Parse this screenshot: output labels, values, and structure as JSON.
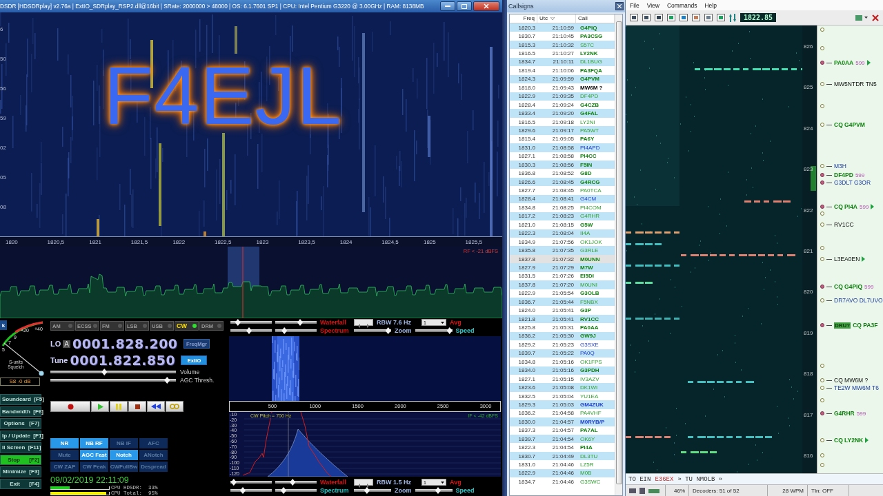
{
  "hdsdr": {
    "title": "DSDR  [HDSDRplay]  v2.76a  |  ExtIO_SDRplay_RSP2.dll@16bit  |  SRate: 2000000 > 48000  |  OS: 6.1.7601 SP1  |  CPU: Intel Pentium G3220 @ 3.00GHz  |  RAM: 8138MB",
    "overlay_text": "F4EJL",
    "time_labels": [
      "6",
      "50",
      "56",
      "59",
      "02",
      "05",
      "08"
    ],
    "freq_axis": [
      "1820",
      "1820,5",
      "1821",
      "1821,5",
      "1822",
      "1822,5",
      "1823",
      "1823,5",
      "1824",
      "1824,5",
      "1825",
      "1825,5"
    ],
    "rf_level": "RF < -21 dBFS",
    "cut_button": "k",
    "meter": {
      "scale": [
        "+20",
        "+40",
        "9",
        "7",
        "5"
      ],
      "label": "S-units Squelch",
      "reading": "S8 -0 dB"
    },
    "modes": [
      {
        "label": "AM",
        "selected": false
      },
      {
        "label": "ECSS",
        "selected": false
      },
      {
        "label": "FM",
        "selected": false
      },
      {
        "label": "LSB",
        "selected": false
      },
      {
        "label": "USB",
        "selected": false
      },
      {
        "label": "CW",
        "selected": true
      },
      {
        "label": "DRM",
        "selected": false
      }
    ],
    "lo": {
      "label": "LO",
      "sub": "A",
      "value": "0001.828.200"
    },
    "tune": {
      "label": "Tune",
      "value": "0001.822.850"
    },
    "side_buttons": [
      {
        "label": "FreqMgr",
        "active": false
      },
      {
        "label": "ExtIO",
        "active": true
      }
    ],
    "sliders": [
      {
        "label": "Volume",
        "level": 0.43
      },
      {
        "label": "AGC Thresh.",
        "level": 0.93
      }
    ],
    "functions": [
      {
        "label": "Soundcard  [F5]",
        "active": false
      },
      {
        "label": "Bandwidth  [F6]",
        "active": false
      },
      {
        "label": "Options   [F7]",
        "active": false
      },
      {
        "label": "lp / Update  [F1]",
        "active": false
      },
      {
        "label": "ll Screen  [F11]",
        "active": false
      },
      {
        "label": "Stop      [F2]",
        "active": true
      },
      {
        "label": "Minimize  [F3]",
        "active": false
      },
      {
        "label": "Exit      [F4]",
        "active": false
      }
    ],
    "dsp": [
      {
        "label": "NR",
        "on": true
      },
      {
        "label": "NB RF",
        "on": true
      },
      {
        "label": "NB IF",
        "on": false
      },
      {
        "label": "AFC",
        "on": false
      },
      {
        "label": "Mute",
        "on": false
      },
      {
        "label": "AGC Fast",
        "on": true
      },
      {
        "label": "Notch",
        "on": true
      },
      {
        "label": "ANotch",
        "on": false
      },
      {
        "label": "CW ZAP",
        "on": false
      },
      {
        "label": "CW Peak",
        "on": false
      },
      {
        "label": "CWFullBw",
        "on": false
      },
      {
        "label": "Despread",
        "on": false
      }
    ],
    "datetime": "09/02/2019 22:11:09",
    "cpu": [
      {
        "text": "CPU HDSDR:  33%",
        "level": 0.33,
        "color": "#20d020"
      },
      {
        "text": "CPU Total:  95%",
        "level": 0.95,
        "color": "#f0f000"
      }
    ],
    "audio": {
      "controls": [
        {
          "waterfall": {
            "label": "Waterfall",
            "highlight": true,
            "sliders": [
              {
                "level": 0.18
              },
              {
                "level": 0.6
              }
            ]
          },
          "rbw": "RBW  7.6 Hz",
          "avg": {
            "value": "1",
            "label": "Avg"
          },
          "spectrum": {
            "label": "Spectrum",
            "highlight": true,
            "sliders": [
              {
                "level": 0.45
              },
              {
                "level": 0.22
              }
            ]
          },
          "zoom": {
            "label": "Zoom",
            "level": 0.92
          },
          "speed": {
            "label": "Speed",
            "level": 0.93
          }
        },
        {
          "waterfall": {
            "label": "Waterfall",
            "highlight": true,
            "sliders": [
              {
                "level": 0.08
              },
              {
                "level": 0.42
              }
            ]
          },
          "rbw": "RBW  1.5 Hz",
          "avg": {
            "value": "1",
            "label": "Avg"
          },
          "spectrum": {
            "label": "Spectrum",
            "highlight": false,
            "sliders": [
              {
                "level": 0.3
              },
              {
                "level": 0.2
              }
            ]
          },
          "zoom": {
            "label": "Zoom",
            "level": 0.35
          },
          "speed": {
            "label": "Speed",
            "level": 0.62
          }
        }
      ],
      "axis": [
        "500",
        "1000",
        "1500",
        "2000",
        "2500",
        "3000"
      ],
      "db_labels": [
        "-10",
        "-20",
        "-30",
        "-40",
        "-50",
        "-60",
        "-70",
        "-80",
        "-90",
        "-100",
        "-110",
        "-120"
      ],
      "pitch": "CW Pitch = 700 Hz",
      "if_level": "IF < -42 dBFS"
    }
  },
  "callsigns": {
    "title": "Callsigns",
    "columns": [
      "Freq",
      "Utc",
      "Call"
    ],
    "rows": [
      {
        "freq": "1820.3",
        "utc": "21:10:59",
        "call": "G4PIQ",
        "kind": "strong",
        "selected": false
      },
      {
        "freq": "1830.7",
        "utc": "21:10:45",
        "call": "PA3CSG",
        "kind": "strong",
        "selected": false
      },
      {
        "freq": "1815.3",
        "utc": "21:10:32",
        "call": "S57C",
        "kind": "weak",
        "selected": false
      },
      {
        "freq": "1816.5",
        "utc": "21:10:27",
        "call": "LY2NK",
        "kind": "strong",
        "selected": false
      },
      {
        "freq": "1834.7",
        "utc": "21:10:11",
        "call": "DL1BUG",
        "kind": "weak",
        "selected": false
      },
      {
        "freq": "1819.4",
        "utc": "21:10:06",
        "call": "PA3FQA",
        "kind": "strong",
        "selected": false
      },
      {
        "freq": "1824.3",
        "utc": "21:09:59",
        "call": "G4PVM",
        "kind": "strong",
        "selected": false
      },
      {
        "freq": "1818.0",
        "utc": "21:09:43",
        "call": "MW6M ?",
        "kind": "query",
        "selected": false
      },
      {
        "freq": "1822.9",
        "utc": "21:09:35",
        "call": "DF4PD",
        "kind": "weak",
        "selected": false
      },
      {
        "freq": "1828.4",
        "utc": "21:09:24",
        "call": "G4CZB",
        "kind": "strong",
        "selected": false
      },
      {
        "freq": "1833.4",
        "utc": "21:09:20",
        "call": "G4FAL",
        "kind": "strong",
        "selected": false
      },
      {
        "freq": "1816.5",
        "utc": "21:09:18",
        "call": "LY2NI",
        "kind": "weak",
        "selected": false
      },
      {
        "freq": "1829.6",
        "utc": "21:09:17",
        "call": "PA5WT",
        "kind": "weak",
        "selected": false
      },
      {
        "freq": "1815.4",
        "utc": "21:09:05",
        "call": "PA6Y",
        "kind": "strong",
        "selected": false
      },
      {
        "freq": "1831.0",
        "utc": "21:08:58",
        "call": "PI4APD",
        "kind": "blue",
        "selected": false
      },
      {
        "freq": "1827.1",
        "utc": "21:08:58",
        "call": "PI4CC",
        "kind": "strong",
        "selected": false
      },
      {
        "freq": "1830.3",
        "utc": "21:08:56",
        "call": "F5IN",
        "kind": "strong",
        "selected": false
      },
      {
        "freq": "1836.8",
        "utc": "21:08:52",
        "call": "G8D",
        "kind": "strong",
        "selected": false
      },
      {
        "freq": "1826.6",
        "utc": "21:08:45",
        "call": "G4RCG",
        "kind": "strong",
        "selected": false
      },
      {
        "freq": "1827.7",
        "utc": "21:08:45",
        "call": "PA0TCA",
        "kind": "weak",
        "selected": false
      },
      {
        "freq": "1828.4",
        "utc": "21:08:41",
        "call": "G4CM",
        "kind": "blue",
        "selected": false
      },
      {
        "freq": "1834.8",
        "utc": "21:08:25",
        "call": "PI4COM",
        "kind": "weak",
        "selected": false
      },
      {
        "freq": "1817.2",
        "utc": "21:08:23",
        "call": "G4RHR",
        "kind": "weak",
        "selected": false
      },
      {
        "freq": "1821.0",
        "utc": "21:08:15",
        "call": "G5W",
        "kind": "strong",
        "selected": false
      },
      {
        "freq": "1822.3",
        "utc": "21:08:04",
        "call": "II4A",
        "kind": "weak",
        "selected": false
      },
      {
        "freq": "1834.9",
        "utc": "21:07:56",
        "call": "OK1JOK",
        "kind": "weak",
        "selected": false
      },
      {
        "freq": "1835.8",
        "utc": "21:07:35",
        "call": "G3RLE",
        "kind": "weak",
        "selected": false
      },
      {
        "freq": "1837.8",
        "utc": "21:07:32",
        "call": "M0UNN",
        "kind": "strong",
        "selected": true
      },
      {
        "freq": "1827.9",
        "utc": "21:07:29",
        "call": "M7W",
        "kind": "strong",
        "selected": false
      },
      {
        "freq": "1831.5",
        "utc": "21:07:26",
        "call": "EI5DI",
        "kind": "strong",
        "selected": false
      },
      {
        "freq": "1837.8",
        "utc": "21:07:20",
        "call": "M0UNI",
        "kind": "weak",
        "selected": false
      },
      {
        "freq": "1822.9",
        "utc": "21:05:54",
        "call": "G3OLB",
        "kind": "strong",
        "selected": false
      },
      {
        "freq": "1836.7",
        "utc": "21:05:44",
        "call": "F5NBX",
        "kind": "weak",
        "selected": false
      },
      {
        "freq": "1824.0",
        "utc": "21:05:41",
        "call": "G3P",
        "kind": "strong",
        "selected": false
      },
      {
        "freq": "1821.8",
        "utc": "21:05:41",
        "call": "RV1CC",
        "kind": "strong",
        "selected": false
      },
      {
        "freq": "1825.8",
        "utc": "21:05:31",
        "call": "PA0AA",
        "kind": "strong",
        "selected": false
      },
      {
        "freq": "1836.2",
        "utc": "21:05:30",
        "call": "GW9J",
        "kind": "strong",
        "selected": false
      },
      {
        "freq": "1829.2",
        "utc": "21:05:23",
        "call": "G3SXE",
        "kind": "blue",
        "selected": false
      },
      {
        "freq": "1839.7",
        "utc": "21:05:22",
        "call": "PA0Q",
        "kind": "blue",
        "selected": false
      },
      {
        "freq": "1834.8",
        "utc": "21:05:16",
        "call": "OK1FPS",
        "kind": "weak",
        "selected": false
      },
      {
        "freq": "1834.0",
        "utc": "21:05:16",
        "call": "G3PDH",
        "kind": "strong",
        "selected": false
      },
      {
        "freq": "1827.1",
        "utc": "21:05:15",
        "call": "IV3AZV",
        "kind": "weak",
        "selected": false
      },
      {
        "freq": "1823.6",
        "utc": "21:05:08",
        "call": "DK1WI",
        "kind": "weak",
        "selected": false
      },
      {
        "freq": "1832.5",
        "utc": "21:05:04",
        "call": "YU1EA",
        "kind": "weak",
        "selected": false
      },
      {
        "freq": "1829.3",
        "utc": "21:05:03",
        "call": "GM4ZUK",
        "kind": "blue-strong",
        "selected": false
      },
      {
        "freq": "1836.2",
        "utc": "21:04:58",
        "call": "PA4VHF",
        "kind": "weak",
        "selected": false
      },
      {
        "freq": "1830.0",
        "utc": "21:04:57",
        "call": "M0RYB/P",
        "kind": "blue-strong",
        "selected": false
      },
      {
        "freq": "1837.3",
        "utc": "21:04:57",
        "call": "PA7AL",
        "kind": "strong",
        "selected": false
      },
      {
        "freq": "1839.7",
        "utc": "21:04:54",
        "call": "OK6Y",
        "kind": "weak",
        "selected": false
      },
      {
        "freq": "1822.3",
        "utc": "21:04:54",
        "call": "PI4A",
        "kind": "strong",
        "selected": false
      },
      {
        "freq": "1830.7",
        "utc": "21:04:49",
        "call": "DL3TU",
        "kind": "weak",
        "selected": false
      },
      {
        "freq": "1831.0",
        "utc": "21:04:46",
        "call": "LZ5R",
        "kind": "weak",
        "selected": false
      },
      {
        "freq": "1822.9",
        "utc": "21:04:46",
        "call": "M0B",
        "kind": "weak",
        "selected": false
      },
      {
        "freq": "1834.7",
        "utc": "21:04:46",
        "call": "G3SWC",
        "kind": "weak",
        "selected": false
      }
    ]
  },
  "skimmer": {
    "menu": [
      "File",
      "View",
      "Commands",
      "Help"
    ],
    "frequency": "1822.85",
    "scale": [
      "826",
      "825",
      "824",
      "823",
      "822",
      "821",
      "820",
      "819",
      "818",
      "817",
      "816"
    ],
    "decodes": [
      {
        "kind": "empty",
        "marked": false,
        "arrow": false
      },
      {
        "kind": "empty",
        "marked": false,
        "arrow": false
      },
      {
        "kind": "call",
        "text": "PA0AA",
        "report": "599",
        "arrow": true,
        "marked": true
      },
      {
        "kind": "plain",
        "text": "MW5NTDR TN5",
        "arrow": false,
        "marked": false
      },
      {
        "kind": "empty",
        "marked": false,
        "arrow": false
      },
      {
        "kind": "call",
        "text": "CQ G4PVM",
        "arrow": false,
        "marked": false
      },
      {
        "kind": "chat",
        "text": "M3H",
        "arrow": false,
        "marked": false
      },
      {
        "kind": "call",
        "text": "DF4PD",
        "report": "599",
        "arrow": false,
        "marked": true
      },
      {
        "kind": "chat",
        "text": "G3DLT G3OR",
        "arrow": false,
        "marked": true
      },
      {
        "kind": "call",
        "text": "CQ PI4A",
        "report": "599",
        "arrow": true,
        "marked": true
      },
      {
        "kind": "empty",
        "marked": false,
        "arrow": false
      },
      {
        "kind": "plain",
        "text": "RV1CC",
        "arrow": false,
        "marked": false
      },
      {
        "kind": "empty",
        "marked": false,
        "arrow": false
      },
      {
        "kind": "plain",
        "text": "L3EA0EN",
        "arrow": true,
        "marked": false
      },
      {
        "kind": "call",
        "text": "CQ G4PIQ",
        "report": "599",
        "arrow": false,
        "marked": true
      },
      {
        "kind": "chat",
        "text": "DR7AVO DL7UVO",
        "arrow": false,
        "marked": false
      },
      {
        "kind": "call",
        "tag": "DRU?",
        "text": "CQ PA3F",
        "arrow": false,
        "marked": true
      },
      {
        "kind": "empty",
        "marked": false,
        "arrow": false
      },
      {
        "kind": "plain",
        "text": "CQ MW6M ?",
        "arrow": false,
        "marked": false
      },
      {
        "kind": "chat",
        "text": "TE2W MW6M T6",
        "arrow": false,
        "marked": false
      },
      {
        "kind": "empty",
        "marked": false,
        "arrow": false
      },
      {
        "kind": "call",
        "text": "G4RHR",
        "report": "599",
        "arrow": false,
        "marked": true
      },
      {
        "kind": "call",
        "text": "CQ LY2NK",
        "arrow": true,
        "marked": false
      },
      {
        "kind": "empty",
        "marked": false,
        "arrow": false
      },
      {
        "kind": "empty",
        "marked": false,
        "arrow": false
      }
    ],
    "text_line": [
      {
        "text": "TO EIN",
        "highlight": false
      },
      {
        "text": "E36EX",
        "highlight": true
      },
      {
        "text": "» TU NMOLB »",
        "highlight": false
      }
    ],
    "status": {
      "load": "46%",
      "decoders": "Decoders: 51 of 52",
      "speed": "28 WPM",
      "tln": "TIn: OFF"
    }
  }
}
